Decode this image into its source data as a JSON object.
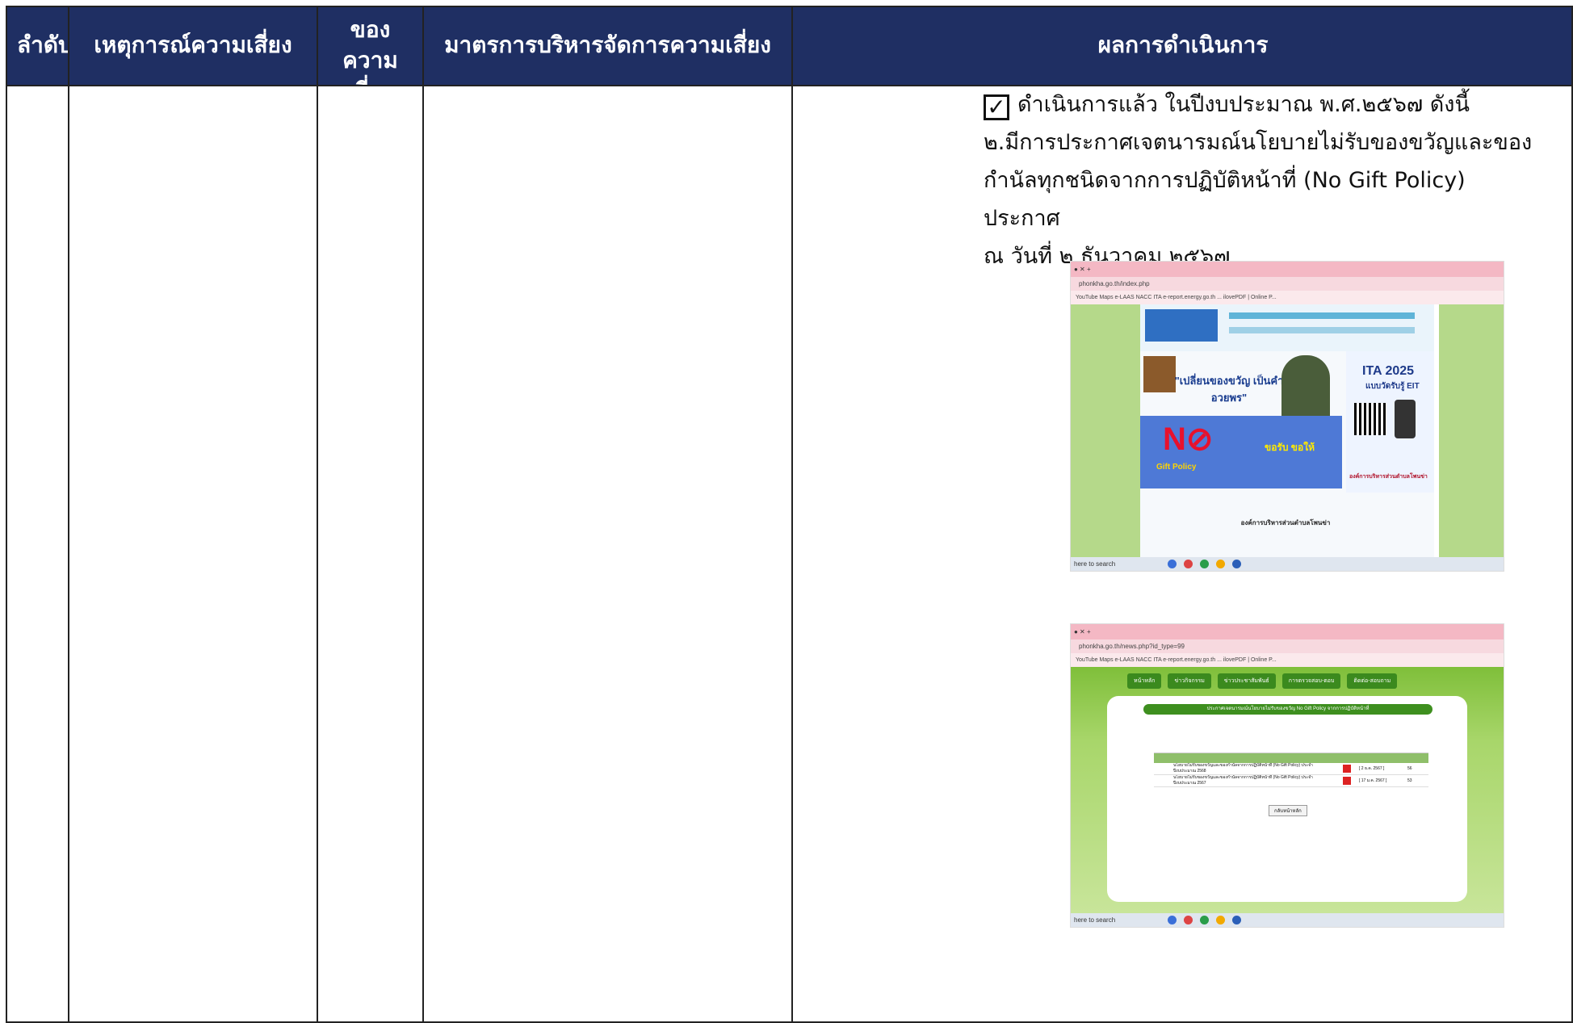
{
  "table": {
    "headers": [
      "ลำดับที่",
      "เหตุการณ์ความเสี่ยง",
      "ระดับของความเสี่ยง",
      "มาตรการบริหารจัดการความเสี่ยง",
      "ผลการดำเนินการ"
    ],
    "result": {
      "check_label": "ดำเนินการแล้ว ในปีงบประมาณ พ.ศ.๒๕๖๗ ดังนี้",
      "line2": "๒.มีการประกาศเจตนารมณ์นโยบายไม่รับของขวัญและของ",
      "line3": "กำนัลทุกชนิดจากการปฏิบัติหน้าที่ (No Gift Policy) ประกาศ",
      "line4": "ณ วันที่ ๒ ธันวาคม ๒๕๖๗"
    }
  },
  "screenshot1": {
    "url": "phonkha.go.th/index.php",
    "bookmarks": "YouTube   Maps   e-LAAS   NACC ITA   e-report.energy.go.th   ...   ilovePDF | Online P...",
    "slogan": "\"เปลี่ยนของขวัญ เป็นคำอวยพร\"",
    "no_gift": "Gift Policy",
    "ita": "ITA 2025",
    "ita_sub": "แบบวัดรับรู้ EIT",
    "org": "องค์การบริหารส่วนตำบลโพนข่า",
    "taskbar": "here to search"
  },
  "screenshot2": {
    "url": "phonkha.go.th/news.php?id_type=99",
    "bookmarks": "YouTube   Maps   e-LAAS   NACC ITA   e-report.energy.go.th   ...   ilovePDF | Online P...",
    "nav": [
      "หน้าหลัก",
      "ข่าวกิจกรรม",
      "ข่าวประชาสัมพันธ์",
      "การตรวจสอบ-ตอบ",
      "ติดต่อ-สอบถาม"
    ],
    "panel_title": "ประกาศเจตนารมณ์นโยบายไม่รับของขวัญ No Gift Policy จากการปฏิบัติหน้าที่",
    "rows": [
      {
        "title": "นโยบายไม่รับของขวัญและของกำนัลจากการปฏิบัติหน้าที่ (No Gift Policy) ประจำปีงบประมาณ 2568",
        "date": "[ 2 ธ.ค. 2567 ]",
        "views": "56"
      },
      {
        "title": "นโยบายไม่รับของขวัญและของกำนัลจากการปฏิบัติหน้าที่ (No Gift Policy) ประจำปีงบประมาณ 2567",
        "date": "[ 17 ม.ค. 2567 ]",
        "views": "53"
      }
    ],
    "back_button": "กลับหน้าหลัก",
    "taskbar": "here to search"
  },
  "colors": {
    "header_bg": "#1f2f63",
    "header_text": "#ffffff",
    "border": "#222222"
  }
}
